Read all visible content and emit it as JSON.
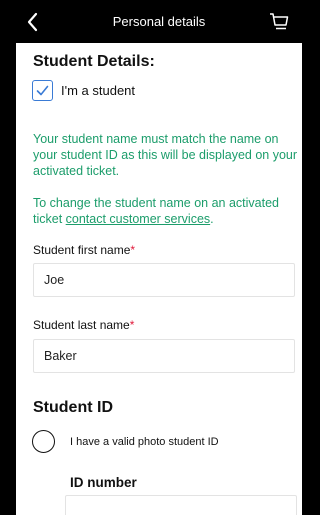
{
  "header": {
    "title": "Personal details",
    "back_icon": "chevron-left-icon",
    "cart_icon": "cart-icon"
  },
  "student_details": {
    "heading": "Student Details:",
    "checkbox_label": "I'm a student",
    "checkbox_checked": true,
    "note1": "Your student name must match the name on your student ID as this will be displayed on your activated ticket.",
    "note2_prefix": "To change the student name on an activated ticket ",
    "note2_link": "contact customer services",
    "note2_suffix": "."
  },
  "fields": {
    "first_name_label": "Student first name",
    "first_name_value": "Joe",
    "last_name_label": "Student last name",
    "last_name_value": "Baker",
    "required_mark": "*"
  },
  "student_id": {
    "heading": "Student ID",
    "radio_label": "I have a valid photo student ID",
    "id_number_label": "ID number",
    "id_number_value": ""
  },
  "colors": {
    "accent_green": "#1c9d6b",
    "checkbox_blue": "#3a7bd5",
    "required_red": "#e0193a"
  }
}
